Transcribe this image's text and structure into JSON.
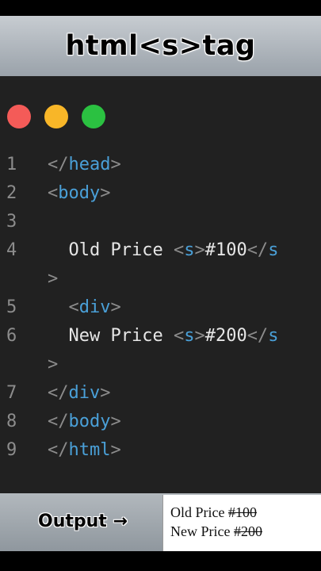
{
  "banner": {
    "title": "html<s>tag"
  },
  "window_controls": [
    "close",
    "minimize",
    "maximize"
  ],
  "code_lines": [
    {
      "num": "1",
      "parts": [
        [
          "br",
          "</"
        ],
        [
          "tag",
          "head"
        ],
        [
          "br",
          ">"
        ]
      ]
    },
    {
      "num": "2",
      "parts": [
        [
          "br",
          "<"
        ],
        [
          "tag",
          "body"
        ],
        [
          "br",
          ">"
        ]
      ]
    },
    {
      "num": "3",
      "parts": []
    },
    {
      "num": "4",
      "parts": [
        [
          "txt",
          "  Old Price "
        ],
        [
          "br",
          "<"
        ],
        [
          "tag",
          "s"
        ],
        [
          "br",
          ">"
        ],
        [
          "txt",
          "#100"
        ],
        [
          "br",
          "</"
        ],
        [
          "tag",
          "s"
        ]
      ]
    },
    {
      "num": "",
      "parts": [
        [
          "br",
          ">"
        ]
      ]
    },
    {
      "num": "5",
      "parts": [
        [
          "br",
          "  <"
        ],
        [
          "tag",
          "div"
        ],
        [
          "br",
          ">"
        ]
      ]
    },
    {
      "num": "6",
      "parts": [
        [
          "txt",
          "  New Price "
        ],
        [
          "br",
          "<"
        ],
        [
          "tag",
          "s"
        ],
        [
          "br",
          ">"
        ],
        [
          "txt",
          "#200"
        ],
        [
          "br",
          "</"
        ],
        [
          "tag",
          "s"
        ]
      ]
    },
    {
      "num": "",
      "parts": [
        [
          "br",
          ">"
        ]
      ]
    },
    {
      "num": "7",
      "parts": [
        [
          "br",
          "</"
        ],
        [
          "tag",
          "div"
        ],
        [
          "br",
          ">"
        ]
      ]
    },
    {
      "num": "8",
      "parts": [
        [
          "br",
          "</"
        ],
        [
          "tag",
          "body"
        ],
        [
          "br",
          ">"
        ]
      ]
    },
    {
      "num": "9",
      "parts": [
        [
          "br",
          "</"
        ],
        [
          "tag",
          "html"
        ],
        [
          "br",
          ">"
        ]
      ]
    }
  ],
  "output": {
    "label": "Output →",
    "line1_prefix": "Old Price ",
    "line1_struck": "#100",
    "line2_prefix": "New Price ",
    "line2_struck": "#200"
  },
  "colors": {
    "editor_bg": "#212121",
    "tag": "#4aa0d8",
    "bracket": "#8c8c8c",
    "text": "#e6e6e6",
    "dot_red": "#f45b58",
    "dot_yellow": "#f8b628",
    "dot_green": "#2bc141"
  }
}
